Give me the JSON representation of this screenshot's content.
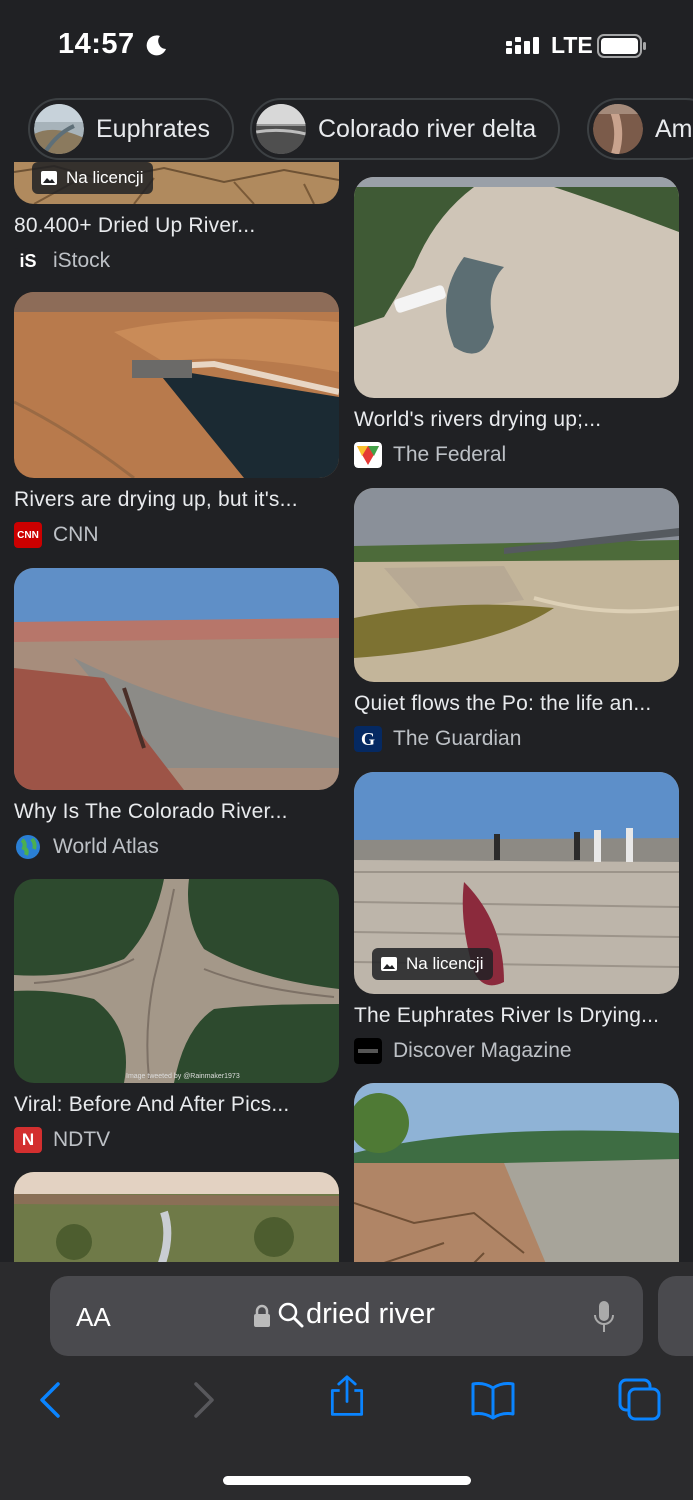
{
  "status_bar": {
    "time": "14:57",
    "network": "LTE"
  },
  "chips": [
    {
      "label": "Euphrates"
    },
    {
      "label": "Colorado river delta"
    },
    {
      "label": "Am"
    }
  ],
  "results": {
    "left": [
      {
        "title": "80.400+ Dried Up River...",
        "source": "iStock",
        "badge": "Na licencji"
      },
      {
        "title": "Rivers are drying up, but it's...",
        "source": "CNN"
      },
      {
        "title": "Why Is The Colorado River...",
        "source": "World Atlas"
      },
      {
        "title": "Viral: Before And After Pics...",
        "source": "NDTV"
      }
    ],
    "right": [
      {
        "title": "World's rivers drying up;...",
        "source": "The Federal"
      },
      {
        "title": "Quiet flows the Po: the life an...",
        "source": "The Guardian"
      },
      {
        "title": "The Euphrates River Is Drying...",
        "source": "Discover Magazine",
        "badge": "Na licencji"
      }
    ]
  },
  "favicons": {
    "istock": "iS",
    "cnn": "CNN",
    "ndtv": "N",
    "guardian": "G"
  },
  "image_caption_small": "Image tweeted by @Rainmaker1973",
  "toolbar": {
    "text_size_label": "AA",
    "query": "dried river"
  },
  "colors": {
    "accent": "#0a84ff",
    "background": "#202124",
    "toolbar": "#2b2b2d"
  }
}
